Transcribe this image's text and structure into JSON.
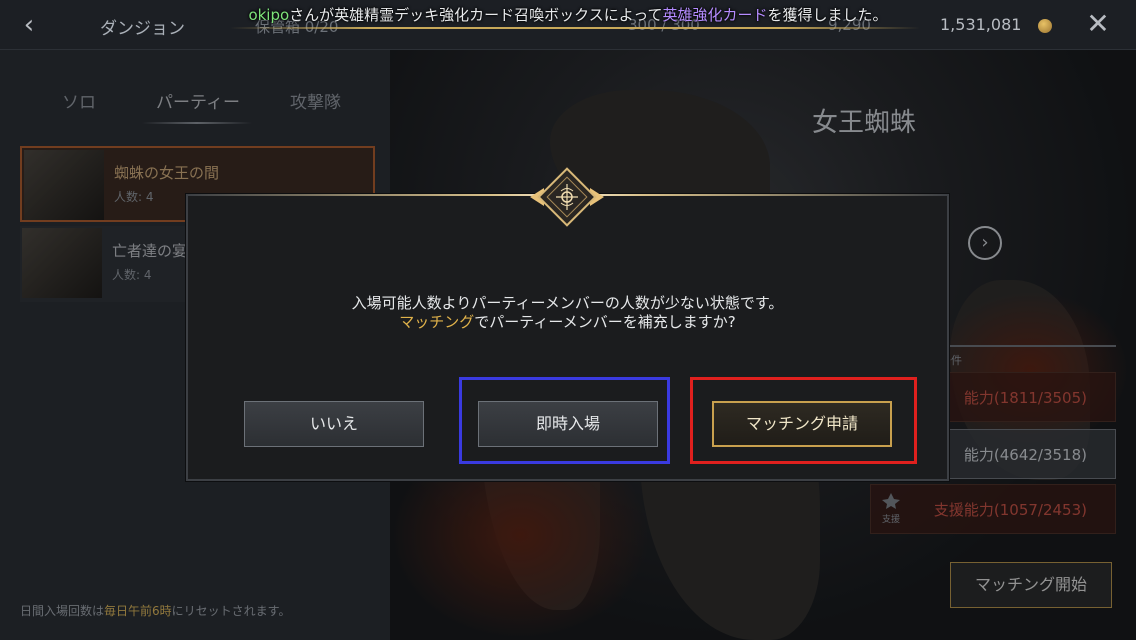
{
  "header": {
    "title": "ダンジョン",
    "faded_left": "保管箱 0/20",
    "faded_mid": "300 / 300",
    "faded_right": "9,290",
    "gold": "1,531,081"
  },
  "notice": {
    "user": "okipo",
    "text_1": "さんが英雄精霊デッキ強化カード召喚ボックスによって",
    "item": "英雄強化カード",
    "text_2": "を獲得しました。"
  },
  "tabs": [
    "ソロ",
    "パーティー",
    "攻撃隊"
  ],
  "dungeons": [
    {
      "name": "蜘蛛の女王の間",
      "count": "人数: 4"
    },
    {
      "name": "亡者達の宴",
      "count": "人数: 4"
    }
  ],
  "reset_note": {
    "prefix": "日間入場回数は",
    "highlight": "毎日午前6時",
    "suffix": "にリセットされます。"
  },
  "boss": {
    "name": "女王蜘蛛"
  },
  "conditions": {
    "label": "条件",
    "rows": [
      {
        "text": "能力(1811/3505)"
      },
      {
        "text": "能力(4642/3518)"
      },
      {
        "text": "支援能力(1057/2453)",
        "icon_label": "支援"
      }
    ]
  },
  "match_start_label": "マッチング開始",
  "dialog": {
    "line1": "入場可能人数よりパーティーメンバーの人数が少ない状態です。",
    "line2_highlight": "マッチング",
    "line2_rest": "でパーティーメンバーを補充しますか?",
    "buttons": {
      "no": "いいえ",
      "instant": "即時入場",
      "matching": "マッチング申請"
    }
  },
  "colors": {
    "focus_blue": "#3a3ae0",
    "focus_red": "#e0201e",
    "accent_gold": "#c8a04e"
  }
}
